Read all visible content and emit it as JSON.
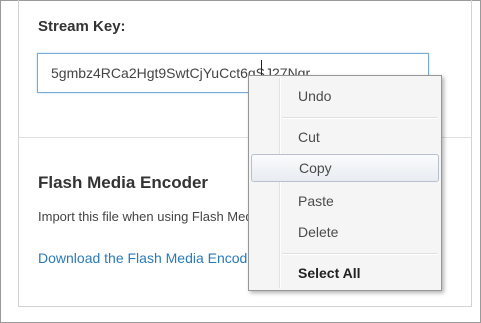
{
  "stream": {
    "label": "Stream Key:",
    "value": "5gmbz4RCa2Hgt9SwtCjYuCct6gSJ27Ngr"
  },
  "encoder": {
    "heading": "Flash Media Encoder",
    "import_text": "Import this file when using Flash Media Live Encoder",
    "download_link": "Download the Flash Media Encoder config file"
  },
  "context_menu": {
    "undo": "Undo",
    "cut": "Cut",
    "copy": "Copy",
    "paste": "Paste",
    "delete": "Delete",
    "select_all": "Select All"
  }
}
